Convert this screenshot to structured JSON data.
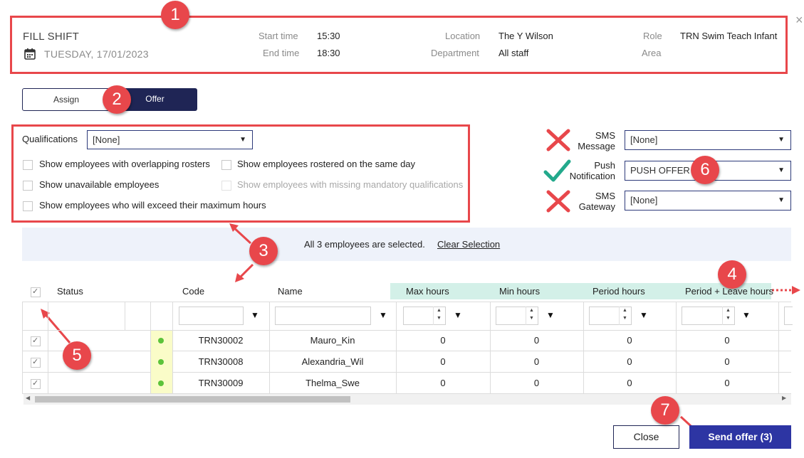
{
  "header": {
    "title": "FILL SHIFT",
    "date": "TUESDAY, 17/01/2023",
    "close_glyph": "×",
    "fields": {
      "start_time_label": "Start time",
      "start_time": "15:30",
      "end_time_label": "End time",
      "end_time": "18:30",
      "location_label": "Location",
      "location": "The Y Wilson",
      "department_label": "Department",
      "department": "All staff",
      "role_label": "Role",
      "role": "TRN Swim Teach Infant",
      "area_label": "Area",
      "area": ""
    }
  },
  "mode_toggle": {
    "assign": "Assign",
    "offer": "Offer",
    "selected": "Offer"
  },
  "filters": {
    "qualifications_label": "Qualifications",
    "qualifications_value": "[None]",
    "options": {
      "overlapping": "Show employees with overlapping rosters",
      "same_day": "Show employees rostered on the same day",
      "unavailable": "Show unavailable employees",
      "missing_quals": "Show employees with missing mandatory qualifications",
      "exceed_max": "Show employees who will exceed their maximum hours"
    }
  },
  "notifications": {
    "sms_message_label_1": "SMS",
    "sms_message_label_2": "Message",
    "sms_message_value": "[None]",
    "push_label_1": "Push",
    "push_label_2": "Notification",
    "push_value": "PUSH OFFER",
    "sms_gateway_label_1": "SMS",
    "sms_gateway_label_2": "Gateway",
    "sms_gateway_value": "[None]"
  },
  "selection": {
    "message": "All 3 employees are selected.",
    "clear": "Clear Selection"
  },
  "table": {
    "headers": {
      "status": "Status",
      "code": "Code",
      "name": "Name",
      "max_hours": "Max hours",
      "min_hours": "Min hours",
      "period_hours": "Period hours",
      "period_leave_hours": "Period + Leave hours"
    },
    "rows": [
      {
        "code": "TRN30002",
        "name": "Mauro_Kin",
        "max": "0",
        "min": "0",
        "period": "0",
        "period_leave": "0"
      },
      {
        "code": "TRN30008",
        "name": "Alexandria_Wil",
        "max": "0",
        "min": "0",
        "period": "0",
        "period_leave": "0"
      },
      {
        "code": "TRN30009",
        "name": "Thelma_Swe",
        "max": "0",
        "min": "0",
        "period": "0",
        "period_leave": "0"
      }
    ]
  },
  "buttons": {
    "close": "Close",
    "send_offer": "Send offer (3)"
  },
  "annotations": {
    "b1": "1",
    "b2": "2",
    "b3": "3",
    "b4": "4",
    "b5": "5",
    "b6": "6",
    "b7": "7"
  },
  "colors": {
    "accent": "#e8474b",
    "primary": "#1f2555",
    "check": "#23a98c",
    "status_dot": "#5cc33a"
  }
}
